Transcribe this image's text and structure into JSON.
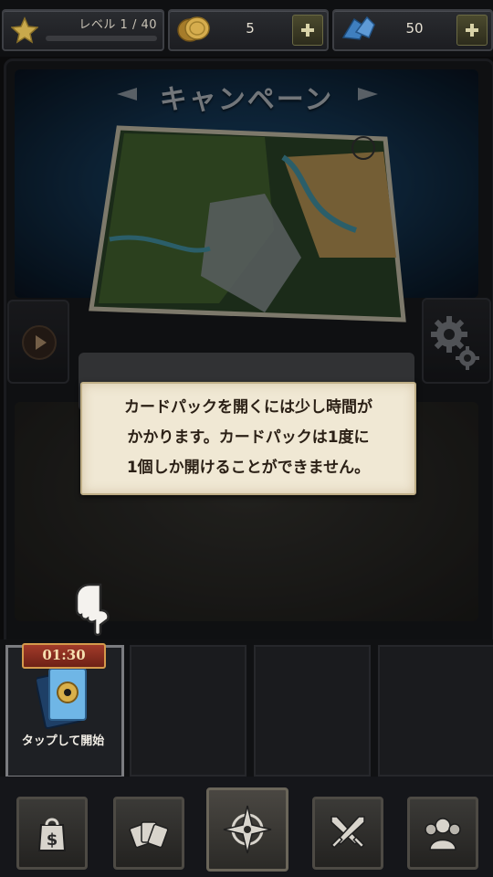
{
  "resources": {
    "level_label": "レベル 1 / 40",
    "level_progress": 0.0,
    "gold_value": "5",
    "gem_value": "50"
  },
  "campaign": {
    "title": "キャンペーン"
  },
  "tooltip": {
    "line1": "カードパックを開くには少し時間が",
    "line2": "かかります。カードパックは1度に",
    "line3": "1個しか開けることができません。"
  },
  "card_slots": {
    "timer": "01:30",
    "slot1_label": "タップして開始"
  },
  "nav": {
    "items": [
      "shop-icon",
      "cards-icon",
      "compass-icon",
      "crossed-swords-icon",
      "guild-icon"
    ],
    "active": "compass-icon"
  },
  "colors": {
    "accent_gold": "#d59a4c",
    "timer_red": "#a23b2a",
    "parchment": "#f0e8d4"
  }
}
